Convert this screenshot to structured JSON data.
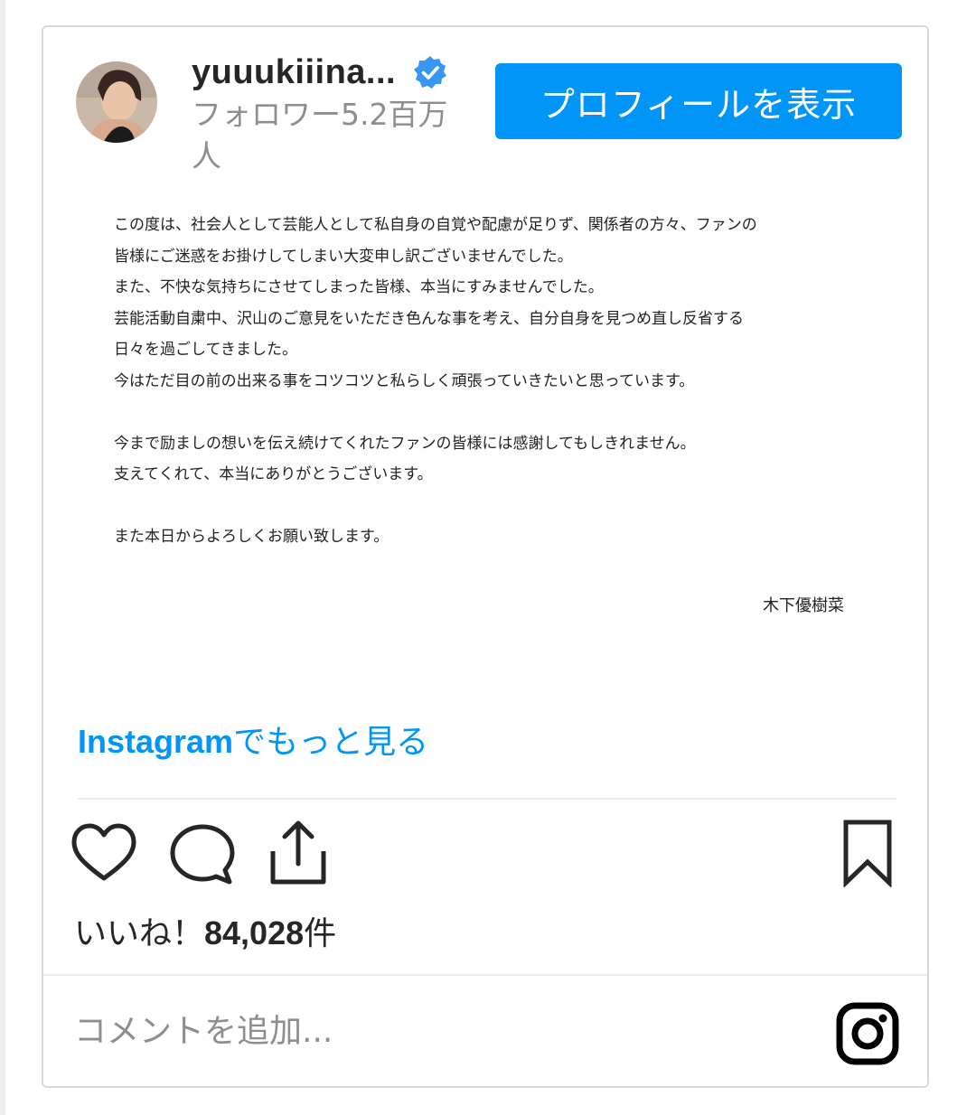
{
  "header": {
    "username": "yuuukiiina...",
    "followers": "フォロワー5.2百万人",
    "profile_button": "プロフィールを表示"
  },
  "letter": {
    "paragraph1": [
      "この度は、社会人として芸能人として私自身の自覚や配慮が足りず、関係者の方々、ファンの",
      "皆様にご迷惑をお掛けしてしまい大変申し訳ございませんでした。",
      "また、不快な気持ちにさせてしまった皆様、本当にすみませんでした。",
      "芸能活動自粛中、沢山のご意見をいただき色んな事を考え、自分自身を見つめ直し反省する",
      "日々を過ごしてきました。",
      "今はただ目の前の出来る事をコツコツと私らしく頑張っていきたいと思っています。"
    ],
    "paragraph2": [
      "今まで励ましの想いを伝え続けてくれたファンの皆様には感謝してもしきれません。",
      "支えてくれて、本当にありがとうございます。"
    ],
    "paragraph3": [
      "また本日からよろしくお願い致します。"
    ],
    "signature": "木下優樹菜"
  },
  "more_link": {
    "brand": "Instagram",
    "rest": "でもっと見る"
  },
  "actions": {
    "icons": [
      "heart-icon",
      "comment-icon",
      "share-icon",
      "bookmark-icon"
    ]
  },
  "likes": {
    "prefix": "いいね！",
    "count": "84,028",
    "suffix": "件"
  },
  "comment": {
    "placeholder": "コメントを追加..."
  },
  "colors": {
    "accent": "#0095f6",
    "verified": "#3897f0",
    "text": "#262626",
    "muted": "#8e8e8e"
  }
}
